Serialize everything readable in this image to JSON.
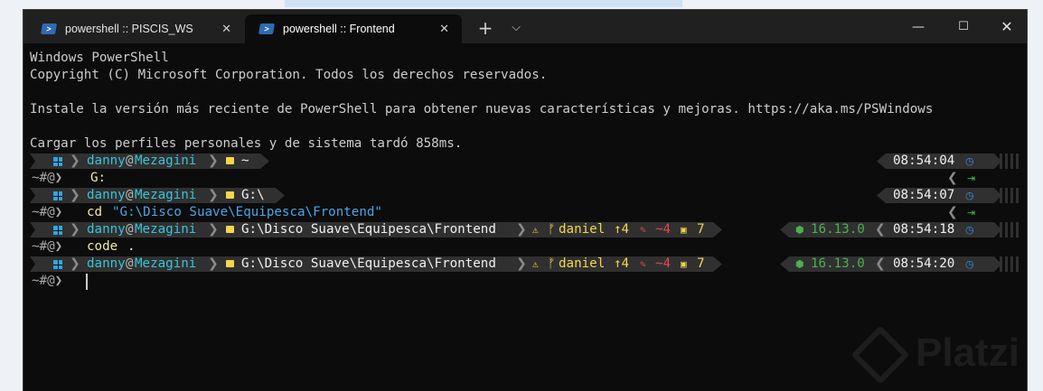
{
  "tabs": [
    {
      "label": "powershell :: PISCIS_WS",
      "active": false
    },
    {
      "label": "powershell :: Frontend",
      "active": true
    }
  ],
  "window_controls": {
    "min": "—",
    "max": "☐",
    "close": "✕"
  },
  "titlebar": {
    "new_tab": "+",
    "dropdown": "⌵",
    "tab_close": "✕"
  },
  "banner": {
    "line1": "Windows PowerShell",
    "line2": "Copyright (C) Microsoft Corporation. Todos los derechos reservados.",
    "line3": "Instale la versión más reciente de PowerShell para obtener nuevas características y mejoras. https://aka.ms/PSWindows",
    "line4": "Cargar los perfiles personales y de sistema tardó 858ms."
  },
  "prompt": {
    "user": "danny",
    "at": "@",
    "host": "Mezagini",
    "symbol": "~#@❯"
  },
  "blocks": [
    {
      "path": "~",
      "time": "08:54:04",
      "command": "G:"
    },
    {
      "path": "G:\\",
      "time": "08:54:07",
      "command_cmd": "cd",
      "command_arg": "\"G:\\Disco Suave\\Equipesca\\Frontend\""
    },
    {
      "path": "G:\\Disco Suave\\Equipesca\\Frontend",
      "git": {
        "branch": "daniel",
        "ahead": "↑4",
        "modified": "~4",
        "staged": "7"
      },
      "node": "16.13.0",
      "time": "08:54:18",
      "command_cmd": "code",
      "command_arg": "."
    },
    {
      "path": "G:\\Disco Suave\\Equipesca\\Frontend",
      "git": {
        "branch": "daniel",
        "ahead": "↑4",
        "modified": "~4",
        "staged": "7"
      },
      "node": "16.13.0",
      "time": "08:54:20"
    }
  ],
  "watermark": "Platzi",
  "colors": {
    "terminal_bg": "#0c0c0c",
    "titlebar_bg": "#202020",
    "accent_cyan": "#36c5d9",
    "git_yellow": "#f5d64a",
    "git_red": "#e0484f",
    "node_green": "#4caf50"
  }
}
